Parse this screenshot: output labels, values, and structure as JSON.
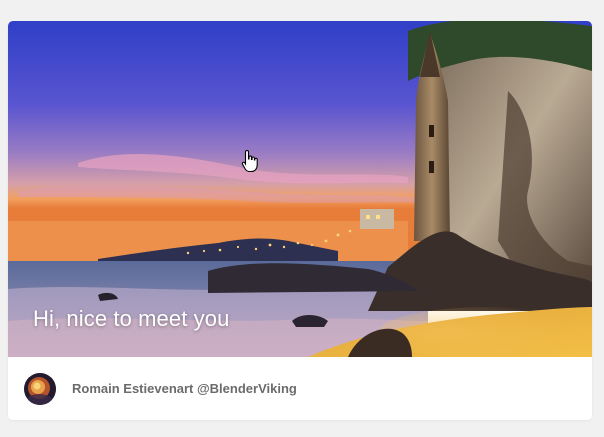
{
  "card": {
    "caption": "Hi, nice to meet you",
    "author": "Romain Estievenart @BlenderViking"
  },
  "icons": {
    "cursor": "hand-pointer-icon",
    "avatar": "user-avatar"
  },
  "colors": {
    "page_background": "#f1f1f1",
    "card_background": "#ffffff",
    "caption_text": "#ffffff",
    "author_text": "#6b6b6b"
  }
}
